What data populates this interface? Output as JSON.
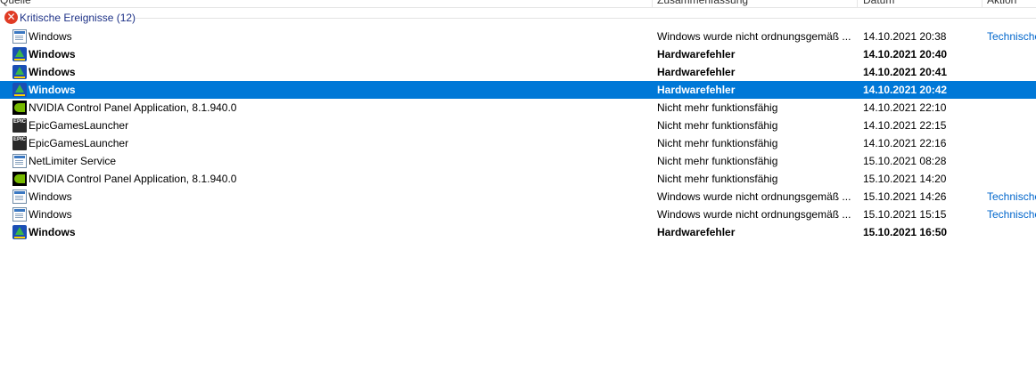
{
  "columns": {
    "source": "Quelle",
    "summary": "Zusammenfassung",
    "date": "Datum",
    "action": "Aktion"
  },
  "group": {
    "label": "Kritische Ereignisse (12)",
    "icon": "error-circle-icon",
    "icon_color": "#e03b24"
  },
  "selected_color": "#0078d7",
  "rows": [
    {
      "icon": "windows-app-icon",
      "source": "Windows",
      "summary": "Windows wurde nicht ordnungsgemäß ...",
      "date": "14.10.2021 20:38",
      "action": "Technische..."
    },
    {
      "icon": "hardware-error-icon",
      "source": "Windows",
      "summary": "Hardwarefehler",
      "date": "14.10.2021 20:40",
      "action": ""
    },
    {
      "icon": "hardware-error-icon",
      "source": "Windows",
      "summary": "Hardwarefehler",
      "date": "14.10.2021 20:41",
      "action": ""
    },
    {
      "icon": "hardware-error-icon",
      "source": "Windows",
      "summary": "Hardwarefehler",
      "date": "14.10.2021 20:42",
      "action": ""
    },
    {
      "icon": "nvidia-icon",
      "source": "NVIDIA Control Panel Application, 8.1.940.0",
      "summary": "Nicht mehr funktionsfähig",
      "date": "14.10.2021 22:10",
      "action": ""
    },
    {
      "icon": "epic-games-icon",
      "source": "EpicGamesLauncher",
      "summary": "Nicht mehr funktionsfähig",
      "date": "14.10.2021 22:15",
      "action": ""
    },
    {
      "icon": "epic-games-icon",
      "source": "EpicGamesLauncher",
      "summary": "Nicht mehr funktionsfähig",
      "date": "14.10.2021 22:16",
      "action": ""
    },
    {
      "icon": "netlimiter-icon",
      "source": "NetLimiter Service",
      "summary": "Nicht mehr funktionsfähig",
      "date": "15.10.2021 08:28",
      "action": ""
    },
    {
      "icon": "nvidia-icon",
      "source": "NVIDIA Control Panel Application, 8.1.940.0",
      "summary": "Nicht mehr funktionsfähig",
      "date": "15.10.2021 14:20",
      "action": ""
    },
    {
      "icon": "windows-app-icon",
      "source": "Windows",
      "summary": "Windows wurde nicht ordnungsgemäß ...",
      "date": "15.10.2021 14:26",
      "action": "Technische..."
    },
    {
      "icon": "windows-app-icon",
      "source": "Windows",
      "summary": "Windows wurde nicht ordnungsgemäß ...",
      "date": "15.10.2021 15:15",
      "action": "Technische..."
    },
    {
      "icon": "hardware-error-icon",
      "source": "Windows",
      "summary": "Hardwarefehler",
      "date": "15.10.2021 16:50",
      "action": ""
    }
  ]
}
